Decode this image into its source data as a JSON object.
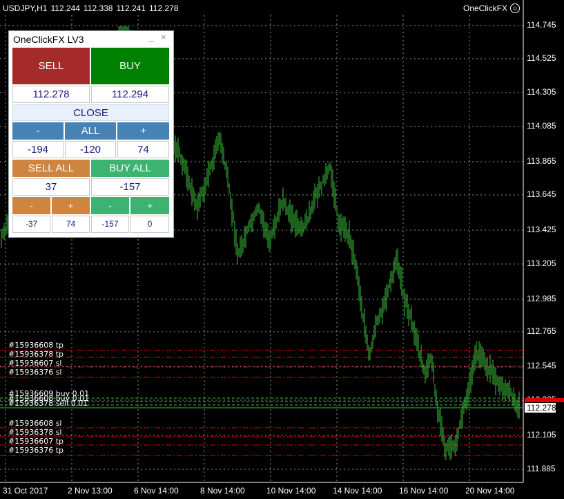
{
  "header": {
    "symbol": "USDJPY,H1",
    "open": "112.244",
    "high": "112.338",
    "low": "112.241",
    "close": "112.278"
  },
  "expert": {
    "name": "OneClickFX",
    "icon": "smiley-icon"
  },
  "price_axis": [
    "114.745",
    "114.525",
    "114.305",
    "114.085",
    "113.865",
    "113.645",
    "113.425",
    "113.205",
    "112.985",
    "112.765",
    "112.545",
    "112.325",
    "112.105",
    "111.885"
  ],
  "current_price": "112.278",
  "time_axis": [
    "31 Oct 2017",
    "2 Nov 13:00",
    "6 Nov 14:00",
    "8 Nov 14:00",
    "10 Nov 14:00",
    "14 Nov 14:00",
    "16 Nov 14:00",
    "20 Nov 14:00"
  ],
  "order_labels": {
    "tp_sl_top": [
      "#15936608 tp",
      "#15936378 tp",
      "#15936607 sl",
      "#15936376 sl"
    ],
    "entries": [
      "#15936609 buy 0.01",
      "#15936608 buy 0.01",
      "#15936378 sell 0.01"
    ],
    "tp_sl_bottom": [
      "#15936608 sl",
      "#15936378 sl",
      "#15936607 tp",
      "#15936376 tp"
    ]
  },
  "panel": {
    "title": "OneClickFX LV3",
    "sell": "SELL",
    "buy": "BUY",
    "bid": "112.278",
    "ask": "112.294",
    "close": "CLOSE",
    "minus": "-",
    "all": "ALL",
    "plus": "+",
    "lot_values": [
      "-194",
      "-120",
      "74"
    ],
    "sell_all": "SELL ALL",
    "buy_all": "BUY ALL",
    "sell_all_value": "37",
    "buy_all_value": "-157",
    "small_values": [
      "-37",
      "74",
      "-157",
      "0"
    ]
  },
  "colors": {
    "sell": "#a52a2a",
    "buy": "#008000",
    "blue_btn": "#4682b4",
    "orange_btn": "#cd853f",
    "green_btn": "#3cb371",
    "close_bg": "#e8f1fb",
    "candles": "#3cbf3c",
    "grid": "#8a9a8a"
  }
}
